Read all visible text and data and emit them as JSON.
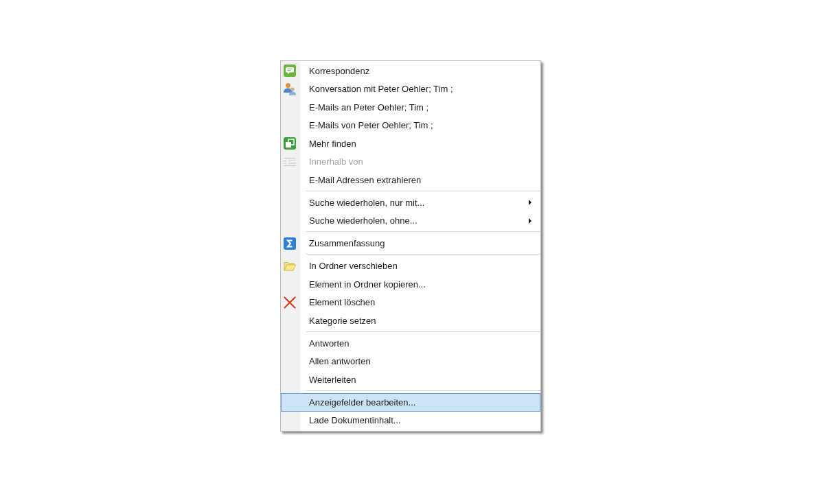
{
  "menu": {
    "groups": [
      {
        "items": [
          {
            "label": "Korrespondenz",
            "disabled": false,
            "selected": false,
            "submenu": false
          },
          {
            "label": "Konversation mit Peter Oehler; Tim ;",
            "disabled": false,
            "selected": false,
            "submenu": false
          },
          {
            "label": "E-Mails an Peter Oehler; Tim ;",
            "disabled": false,
            "selected": false,
            "submenu": false
          },
          {
            "label": "E-Mails von Peter Oehler; Tim ;",
            "disabled": false,
            "selected": false,
            "submenu": false
          },
          {
            "label": "Mehr finden",
            "disabled": false,
            "selected": false,
            "submenu": false
          },
          {
            "label": "Innerhalb von",
            "disabled": true,
            "selected": false,
            "submenu": false
          },
          {
            "label": "E-Mail Adressen extrahieren",
            "disabled": false,
            "selected": false,
            "submenu": false
          }
        ]
      },
      {
        "items": [
          {
            "label": "Suche wiederholen, nur mit...",
            "disabled": false,
            "selected": false,
            "submenu": true
          },
          {
            "label": "Suche wiederholen, ohne...",
            "disabled": false,
            "selected": false,
            "submenu": true
          }
        ]
      },
      {
        "items": [
          {
            "label": "Zusammenfassung",
            "disabled": false,
            "selected": false,
            "submenu": false
          }
        ]
      },
      {
        "items": [
          {
            "label": "In Ordner verschieben",
            "disabled": false,
            "selected": false,
            "submenu": false
          },
          {
            "label": "Element in Ordner kopieren...",
            "disabled": false,
            "selected": false,
            "submenu": false
          },
          {
            "label": "Element löschen",
            "disabled": false,
            "selected": false,
            "submenu": false
          },
          {
            "label": "Kategorie setzen",
            "disabled": false,
            "selected": false,
            "submenu": false
          }
        ]
      },
      {
        "items": [
          {
            "label": "Antworten",
            "disabled": false,
            "selected": false,
            "submenu": false
          },
          {
            "label": "Allen antworten",
            "disabled": false,
            "selected": false,
            "submenu": false
          },
          {
            "label": "Weiterleiten",
            "disabled": false,
            "selected": false,
            "submenu": false
          }
        ]
      },
      {
        "items": [
          {
            "label": "Anzeigefelder bearbeiten...",
            "disabled": false,
            "selected": true,
            "submenu": false
          },
          {
            "label": "Lade Dokumentinhalt...",
            "disabled": false,
            "selected": false,
            "submenu": false
          }
        ]
      }
    ]
  }
}
